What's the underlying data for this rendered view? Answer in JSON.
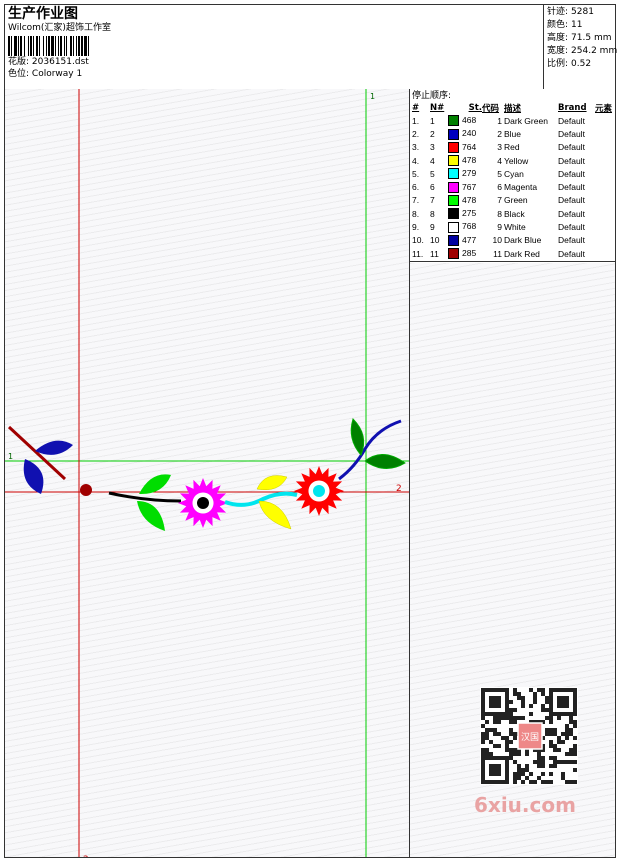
{
  "header": {
    "title": "生产作业图",
    "subtitle": "Wilcom(汇家)超饰工作室",
    "design_label": "花版:",
    "design_value": "2036151.dst",
    "colorway_label": "色位:",
    "colorway_value": "Colorway 1"
  },
  "stats": [
    {
      "label": "针迹:",
      "value": "5281"
    },
    {
      "label": "颜色:",
      "value": "11"
    },
    {
      "label": "高度:",
      "value": "71.5 mm"
    },
    {
      "label": "宽度:",
      "value": "254.2 mm"
    },
    {
      "label": "比例:",
      "value": "0.52"
    }
  ],
  "canvas": {
    "marker_1_top": "1",
    "marker_1_left": "1",
    "marker_2_right": "2",
    "marker_2_bottom": "2",
    "crosshair_color": "#00cc00",
    "origin_color": "#cc0000"
  },
  "thread_panel": {
    "heading": "停止顺序:",
    "columns": [
      "#",
      "N#",
      "St.",
      "代码",
      "描述",
      "Brand",
      "元素"
    ],
    "rows": [
      {
        "idx": "1.",
        "n": "1",
        "st": "468",
        "code": "1",
        "desc": "Dark Green",
        "brand": "Default",
        "color": "#008000"
      },
      {
        "idx": "2.",
        "n": "2",
        "st": "240",
        "code": "2",
        "desc": "Blue",
        "brand": "Default",
        "color": "#0000c0"
      },
      {
        "idx": "3.",
        "n": "3",
        "st": "764",
        "code": "3",
        "desc": "Red",
        "brand": "Default",
        "color": "#ff0000"
      },
      {
        "idx": "4.",
        "n": "4",
        "st": "478",
        "code": "4",
        "desc": "Yellow",
        "brand": "Default",
        "color": "#ffff00"
      },
      {
        "idx": "5.",
        "n": "5",
        "st": "279",
        "code": "5",
        "desc": "Cyan",
        "brand": "Default",
        "color": "#00ffff"
      },
      {
        "idx": "6.",
        "n": "6",
        "st": "767",
        "code": "6",
        "desc": "Magenta",
        "brand": "Default",
        "color": "#ff00ff"
      },
      {
        "idx": "7.",
        "n": "7",
        "st": "478",
        "code": "7",
        "desc": "Green",
        "brand": "Default",
        "color": "#00ff00"
      },
      {
        "idx": "8.",
        "n": "8",
        "st": "275",
        "code": "8",
        "desc": "Black",
        "brand": "Default",
        "color": "#000000"
      },
      {
        "idx": "9.",
        "n": "9",
        "st": "768",
        "code": "9",
        "desc": "White",
        "brand": "Default",
        "color": "#ffffff"
      },
      {
        "idx": "10.",
        "n": "10",
        "st": "477",
        "code": "10",
        "desc": "Dark Blue",
        "brand": "Default",
        "color": "#0000a0"
      },
      {
        "idx": "11.",
        "n": "11",
        "st": "285",
        "code": "11",
        "desc": "Dark Red",
        "brand": "Default",
        "color": "#a00000"
      }
    ]
  },
  "watermark": {
    "seal_text": "汉国",
    "site_text": "6xiu.com"
  }
}
